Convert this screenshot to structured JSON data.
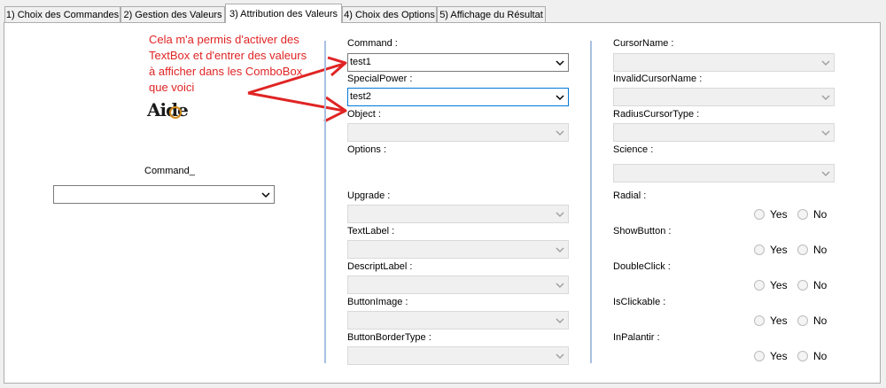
{
  "tabs": [
    "1) Choix des Commandes",
    "2) Gestion des Valeurs",
    "3) Attribution des Valeurs",
    "4) Choix des Options",
    "5) Affichage du Résultat"
  ],
  "annotation": {
    "lines": [
      "Cela m'a permis d'activer des",
      "TextBox et d'entrer des valeurs",
      "à afficher dans les ComboBox",
      "que voici"
    ],
    "color": "#e02424"
  },
  "logo_text": "Aide",
  "left": {
    "label": "Command_",
    "value": ""
  },
  "middle": {
    "command": {
      "label": "Command :",
      "value": "test1"
    },
    "special_power": {
      "label": "SpecialPower :",
      "value": "test2"
    },
    "object": {
      "label": "Object :"
    },
    "options": {
      "label": "Options :"
    },
    "upgrade": {
      "label": "Upgrade :"
    },
    "text_label": {
      "label": "TextLabel :"
    },
    "descript_label": {
      "label": "DescriptLabel :"
    },
    "button_image": {
      "label": "ButtonImage :"
    },
    "button_border_type": {
      "label": "ButtonBorderType :"
    }
  },
  "right": {
    "cursor_name": {
      "label": "CursorName :"
    },
    "invalid_cursor_name": {
      "label": "InvalidCursorName :"
    },
    "radius_cursor_type": {
      "label": "RadiusCursorType :"
    },
    "science": {
      "label": "Science :"
    },
    "radial": {
      "label": "Radial :"
    },
    "show_button": {
      "label": "ShowButton :"
    },
    "double_click": {
      "label": "DoubleClick :"
    },
    "is_clickable": {
      "label": "IsClickable :"
    },
    "in_palantir": {
      "label": "InPalantir :"
    },
    "yes": "Yes",
    "no": "No"
  },
  "colors": {
    "accent": "#0078d7",
    "divider": "#a8c0e0"
  }
}
